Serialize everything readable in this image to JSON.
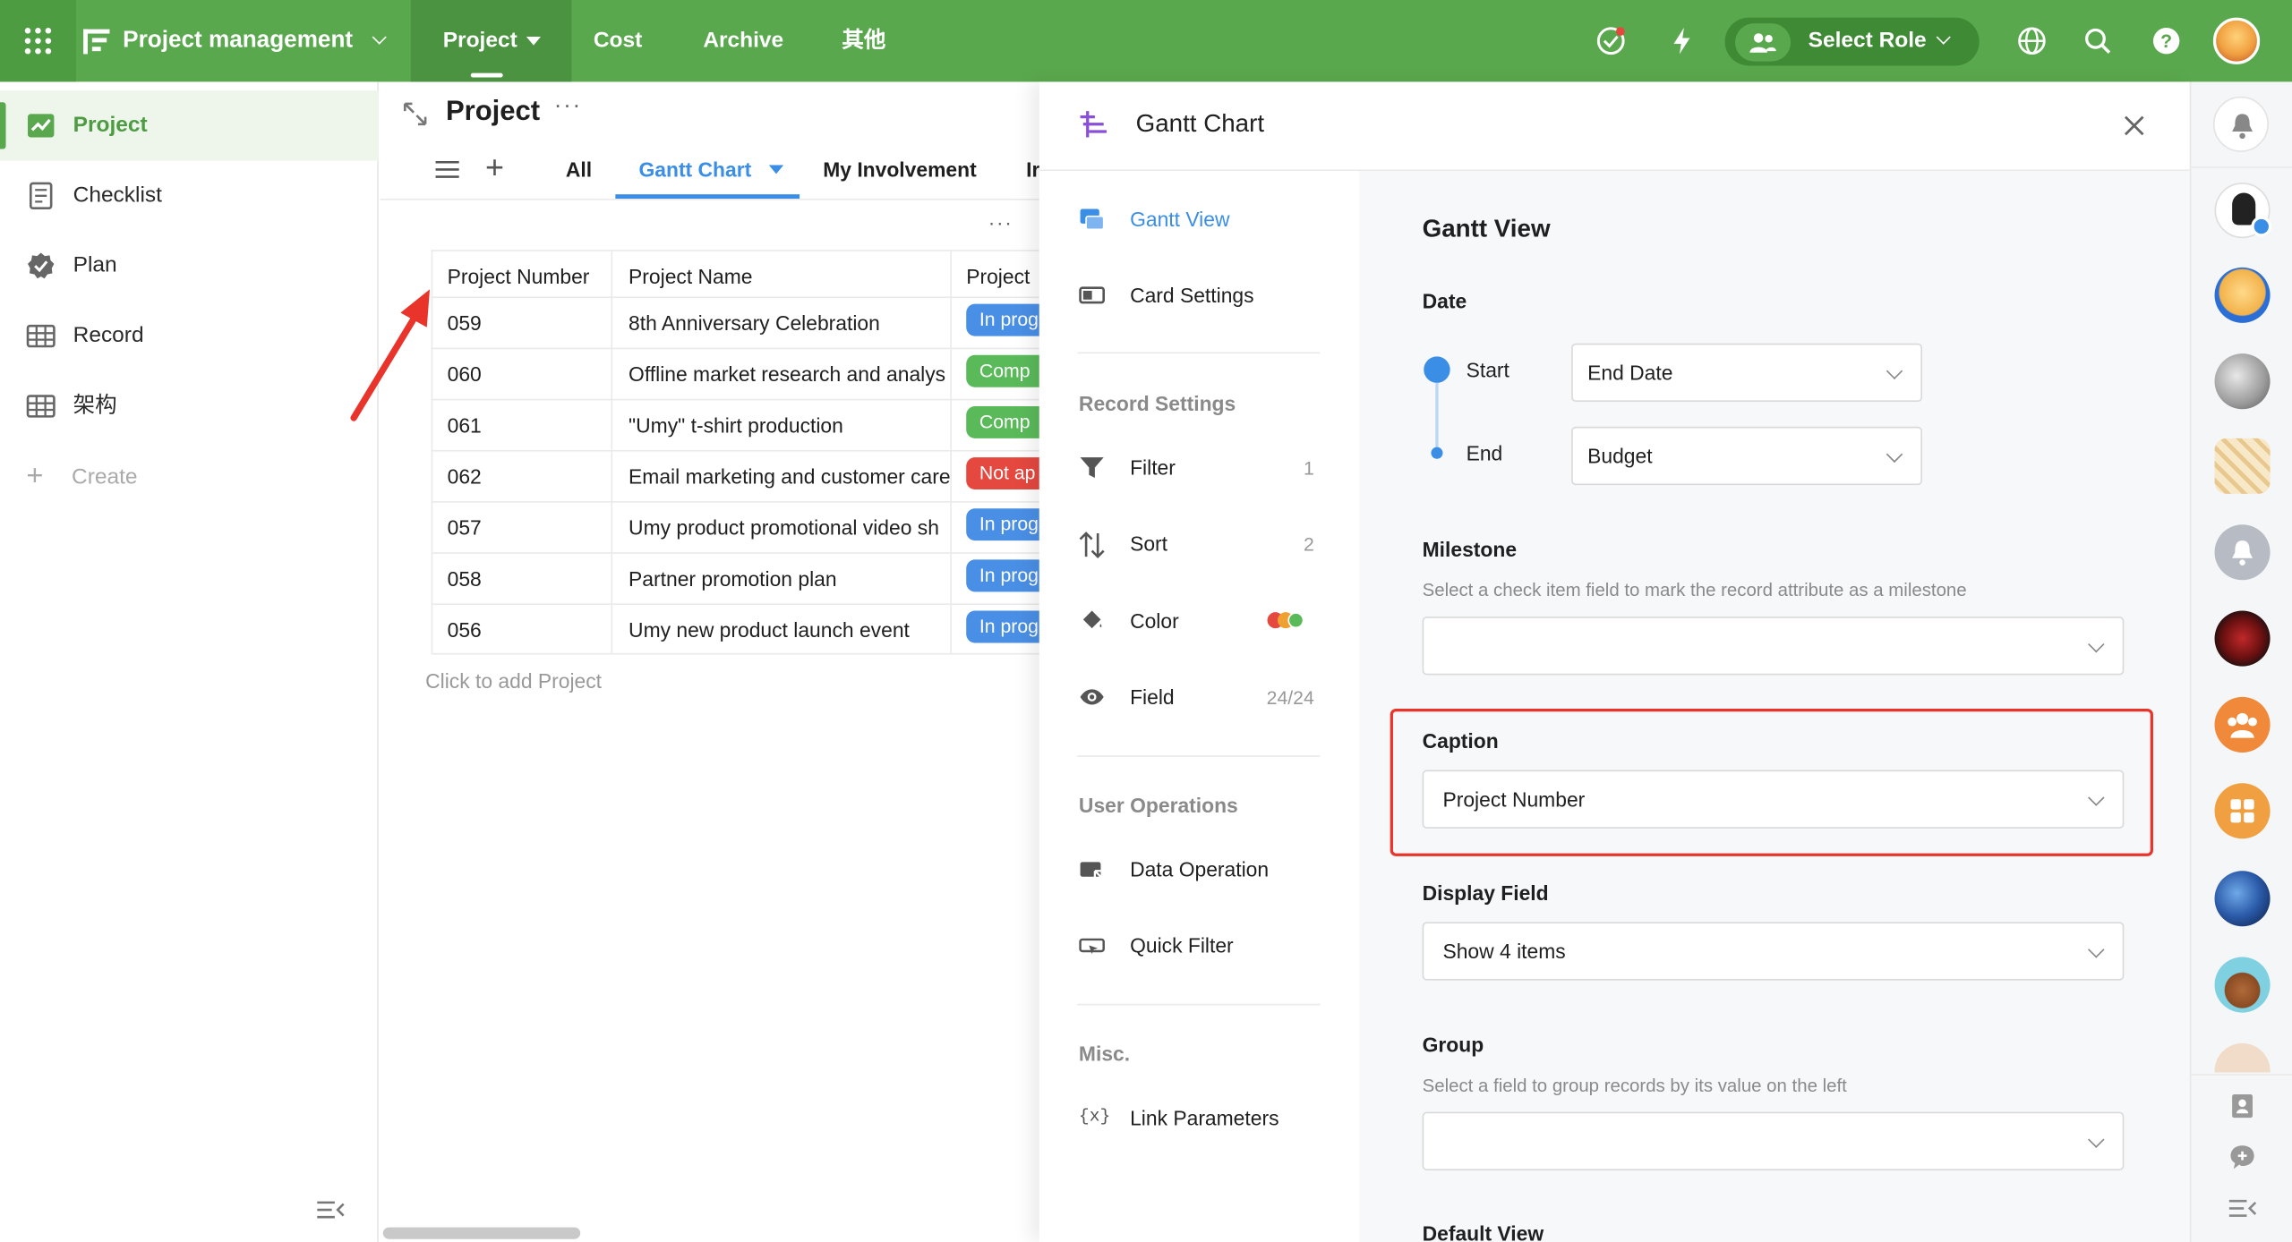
{
  "topbar": {
    "app_title": "Project management",
    "tabs": [
      "Project",
      "Cost",
      "Archive",
      "其他"
    ],
    "role_label": "Select Role"
  },
  "sidebar": {
    "items": [
      {
        "label": "Project",
        "icon": "project-chart-icon"
      },
      {
        "label": "Checklist",
        "icon": "checklist-icon"
      },
      {
        "label": "Plan",
        "icon": "plan-badge-icon"
      },
      {
        "label": "Record",
        "icon": "table-grid-icon"
      },
      {
        "label": "架构",
        "icon": "table-grid-icon"
      }
    ],
    "create_label": "Create"
  },
  "sheet": {
    "title": "Project",
    "views": [
      "All",
      "Gantt Chart",
      "My Involvement",
      "Ir"
    ],
    "columns": [
      "Project Number",
      "Project Name",
      "Project"
    ],
    "rows": [
      {
        "number": "059",
        "name": "8th Anniversary Celebration",
        "status": "In prog",
        "color": "#4a8fe6"
      },
      {
        "number": "060",
        "name": "Offline market research and analys",
        "status": "Comp",
        "color": "#5aba5a"
      },
      {
        "number": "061",
        "name": "\"Umy\" t-shirt production",
        "status": "Comp",
        "color": "#5aba5a"
      },
      {
        "number": "062",
        "name": "Email marketing and customer care",
        "status": "Not ap",
        "color": "#e5483f"
      },
      {
        "number": "057",
        "name": "Umy product promotional video sh",
        "status": "In prog",
        "color": "#4a8fe6"
      },
      {
        "number": "058",
        "name": "Partner promotion plan",
        "status": "In prog",
        "color": "#4a8fe6"
      },
      {
        "number": "056",
        "name": "Umy new product launch event",
        "status": "In prog",
        "color": "#4a8fe6"
      }
    ],
    "add_hint": "Click to add Project"
  },
  "panel": {
    "title": "Gantt Chart",
    "nav": {
      "gantt_view": "Gantt View",
      "card_settings": "Card Settings",
      "record_settings": "Record Settings",
      "filter": "Filter",
      "filter_count": "1",
      "sort": "Sort",
      "sort_count": "2",
      "color": "Color",
      "field": "Field",
      "field_count": "24/24",
      "user_operations": "User Operations",
      "data_operation": "Data Operation",
      "quick_filter": "Quick Filter",
      "misc": "Misc.",
      "link_parameters": "Link Parameters"
    },
    "content": {
      "heading": "Gantt View",
      "date_label": "Date",
      "start_label": "Start",
      "start_value": "End Date",
      "end_label": "End",
      "end_value": "Budget",
      "milestone_label": "Milestone",
      "milestone_desc": "Select a check item field to mark the record attribute as a milestone",
      "milestone_value": "",
      "caption_label": "Caption",
      "caption_value": "Project Number",
      "display_field_label": "Display Field",
      "display_field_value": "Show 4 items",
      "group_label": "Group",
      "group_desc": "Select a field to group records by its value on the left",
      "group_value": "",
      "default_view_label": "Default View"
    }
  },
  "colors": {
    "brand_green": "#5aa84d",
    "accent_blue": "#3a8ee6",
    "highlight_red": "#e8342b"
  }
}
